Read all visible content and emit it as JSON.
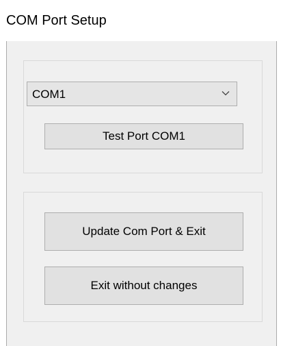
{
  "window": {
    "title": "COM Port Setup"
  },
  "port_select": {
    "selected": "COM1",
    "dropdown_icon": "chevron-down-icon"
  },
  "buttons": {
    "test_port": "Test Port COM1",
    "update_exit": "Update Com Port & Exit",
    "exit_no_change": "Exit without changes"
  }
}
